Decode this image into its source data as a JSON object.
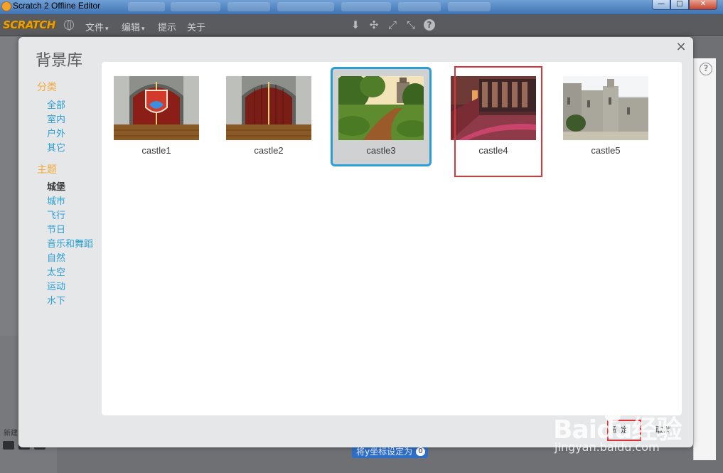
{
  "window": {
    "title": "Scratch 2 Offline Editor",
    "minimize_glyph": "—",
    "maximize_glyph": "□",
    "close_glyph": "✕"
  },
  "menubar": {
    "logo": "SCRATCH",
    "file": "文件",
    "edit": "编辑",
    "tips": "提示",
    "about": "关于",
    "caret": "▾",
    "icons": [
      "stamp-icon",
      "cut-icon",
      "grow-icon",
      "shrink-icon",
      "help-icon"
    ],
    "icon_glyphs": [
      "⬇",
      "✣",
      "⤢",
      "⤡"
    ],
    "help_glyph": "?"
  },
  "dialog": {
    "title": "背景库",
    "close_glyph": "×",
    "category_heading": "分类",
    "categories": [
      "全部",
      "室内",
      "户外",
      "其它"
    ],
    "theme_heading": "主题",
    "themes": [
      "城堡",
      "城市",
      "飞行",
      "节日",
      "音乐和舞蹈",
      "自然",
      "太空",
      "运动",
      "水下"
    ],
    "active_theme": "城堡",
    "items": [
      {
        "label": "castle1",
        "selected": false
      },
      {
        "label": "castle2",
        "selected": false
      },
      {
        "label": "castle3",
        "selected": true
      },
      {
        "label": "castle4",
        "selected": false
      },
      {
        "label": "castle5",
        "selected": false
      }
    ],
    "ok_button": "确定",
    "cancel_button": "取消"
  },
  "editor": {
    "new_label": "新建",
    "block_text": "将y坐标设定为",
    "block_value": "0",
    "right_help_glyph": "?"
  },
  "watermark": {
    "brand": "Baidu经验",
    "url": "jingyan.baidu.com"
  },
  "colors": {
    "accent_blue": "#2a9fd6",
    "heading_orange": "#f6a93b",
    "annotation_red": "#d9343a",
    "menubar": "#5a5b5f"
  }
}
